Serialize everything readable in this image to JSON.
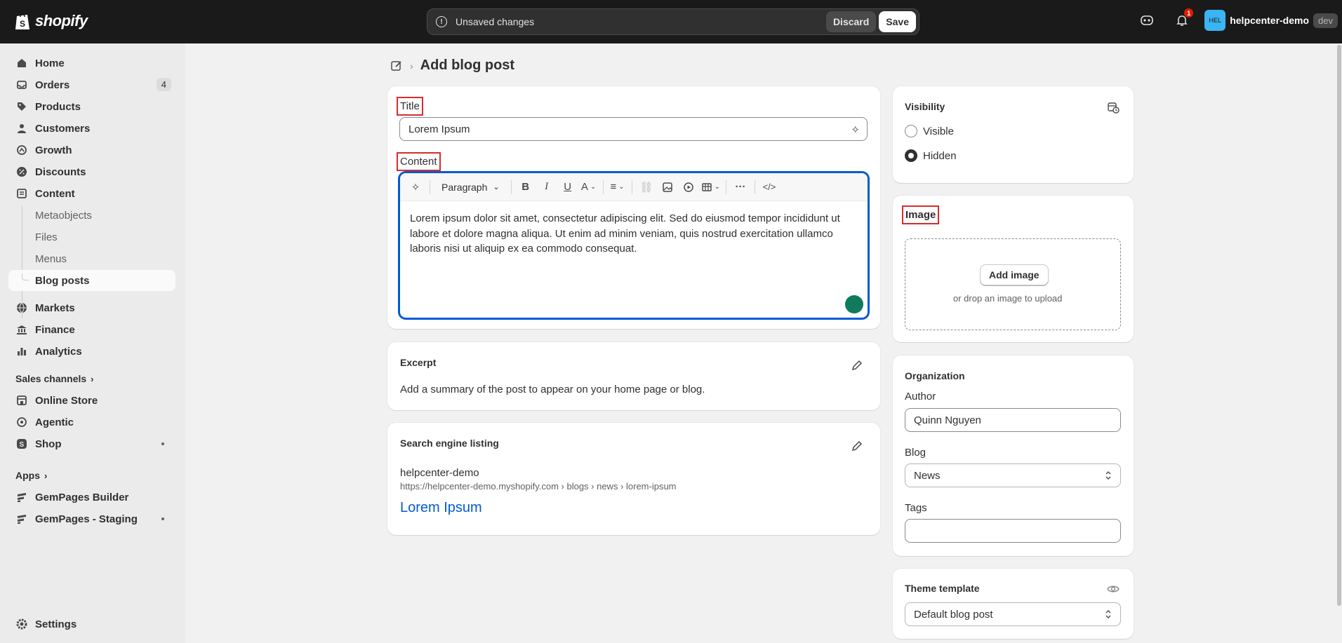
{
  "topbar": {
    "brand": "shopify",
    "unsaved_text": "Unsaved changes",
    "discard_label": "Discard",
    "save_label": "Save",
    "notification_count": "1",
    "avatar_initials": "HEL",
    "store_name": "helpcenter-demo",
    "dev_badge": "dev"
  },
  "sidebar": {
    "home": "Home",
    "orders": "Orders",
    "orders_count": "4",
    "products": "Products",
    "customers": "Customers",
    "growth": "Growth",
    "discounts": "Discounts",
    "content": "Content",
    "metaobjects": "Metaobjects",
    "files": "Files",
    "menus": "Menus",
    "blog_posts": "Blog posts",
    "markets": "Markets",
    "finance": "Finance",
    "analytics": "Analytics",
    "sales_channels": "Sales channels",
    "online_store": "Online Store",
    "agentic": "Agentic",
    "shop": "Shop",
    "apps": "Apps",
    "gempages_builder": "GemPages Builder",
    "gempages_staging": "GemPages - Staging",
    "settings": "Settings"
  },
  "page": {
    "title": "Add blog post"
  },
  "post": {
    "title_label": "Title",
    "title_value": "Lorem Ipsum",
    "content_label": "Content",
    "paragraph_label": "Paragraph",
    "content_text": "Lorem ipsum dolor sit amet, consectetur adipiscing elit. Sed do eiusmod tempor incididunt ut labore et dolore magna aliqua. Ut enim ad minim veniam, quis nostrud exercitation ullamco laboris nisi ut aliquip ex ea commodo consequat."
  },
  "excerpt": {
    "heading": "Excerpt",
    "description": "Add a summary of the post to appear on your home page or blog."
  },
  "seo": {
    "heading": "Search engine listing",
    "site_name": "helpcenter-demo",
    "url": "https://helpcenter-demo.myshopify.com › blogs › news › lorem-ipsum",
    "page_title": "Lorem Ipsum"
  },
  "visibility": {
    "heading": "Visibility",
    "visible_label": "Visible",
    "hidden_label": "Hidden"
  },
  "image": {
    "heading": "Image",
    "add_label": "Add image",
    "drop_text": "or drop an image to upload"
  },
  "organization": {
    "heading": "Organization",
    "author_label": "Author",
    "author_value": "Quinn Nguyen",
    "blog_label": "Blog",
    "blog_value": "News",
    "tags_label": "Tags",
    "tags_value": ""
  },
  "theme": {
    "heading": "Theme template",
    "value": "Default blog post"
  },
  "colors": {
    "accent_blue": "#005bd3",
    "highlight_red": "#d82c2c",
    "topbar_bg": "#1a1a1a"
  }
}
